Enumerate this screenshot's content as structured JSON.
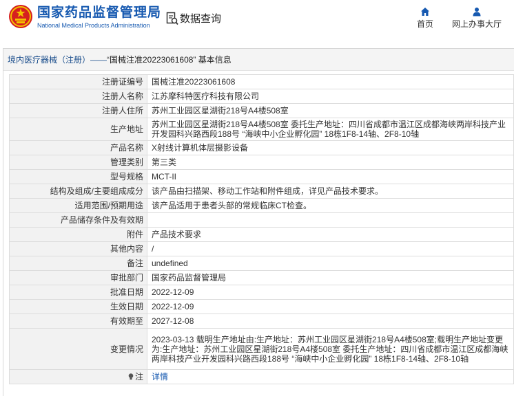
{
  "header": {
    "brand_cn": "国家药品监督管理局",
    "brand_en": "National Medical Products Administration",
    "search_label": "数据查询",
    "home_label": "首页",
    "office_label": "网上办事大厅"
  },
  "breadcrumb": {
    "prefix": "境内医疗器械（注册）",
    "separator": " —— ",
    "title": "“国械注准20223061608” 基本信息"
  },
  "rows": [
    {
      "label": "注册证编号",
      "value": "国械注准20223061608"
    },
    {
      "label": "注册人名称",
      "value": "江苏摩科特医疗科技有限公司"
    },
    {
      "label": "注册人住所",
      "value": "苏州工业园区星湖街218号A4楼508室"
    },
    {
      "label": "生产地址",
      "value": "苏州工业园区星湖街218号A4楼508室 委托生产地址：四川省成都市温江区成都海峡两岸科技产业开发园科兴路西段188号 “海峡中小企业孵化园” 18栋1F8-14轴、2F8-10轴"
    },
    {
      "label": "产品名称",
      "value": "X射线计算机体层摄影设备"
    },
    {
      "label": "管理类别",
      "value": "第三类"
    },
    {
      "label": "型号规格",
      "value": "MCT-II"
    },
    {
      "label": "结构及组成/主要组成成分",
      "value": "该产品由扫描架、移动工作站和附件组成，详见产品技术要求。"
    },
    {
      "label": "适用范围/预期用途",
      "value": "该产品适用于患者头部的常规临床CT检查。"
    },
    {
      "label": "产品储存条件及有效期",
      "value": ""
    },
    {
      "label": "附件",
      "value": "产品技术要求"
    },
    {
      "label": "其他内容",
      "value": "/"
    },
    {
      "label": "备注",
      "value": "undefined"
    },
    {
      "label": "审批部门",
      "value": "国家药品监督管理局"
    },
    {
      "label": "批准日期",
      "value": "2022-12-09"
    },
    {
      "label": "生效日期",
      "value": "2022-12-09"
    },
    {
      "label": "有效期至",
      "value": "2027-12-08"
    },
    {
      "label": "变更情况",
      "value": "2023-03-13 载明生产地址由:生产地址：苏州工业园区星湖街218号A4楼508室;载明生产地址变更为:生产地址：苏州工业园区星湖街218号A4楼508室 委托生产地址：四川省成都市温江区成都海峡两岸科技产业开发园科兴路西段188号 “海峡中小企业孵化园” 18栋1F8-14轴、2F8-10轴"
    }
  ],
  "note": {
    "label": "注",
    "link": "详情"
  },
  "colors": {
    "brand_blue": "#1659b0",
    "emblem_red": "#d61f1f",
    "emblem_gold": "#f2c200"
  },
  "icons": [
    "national-emblem-icon",
    "search-doc-icon",
    "home-icon",
    "user-icon",
    "bulb-icon"
  ]
}
